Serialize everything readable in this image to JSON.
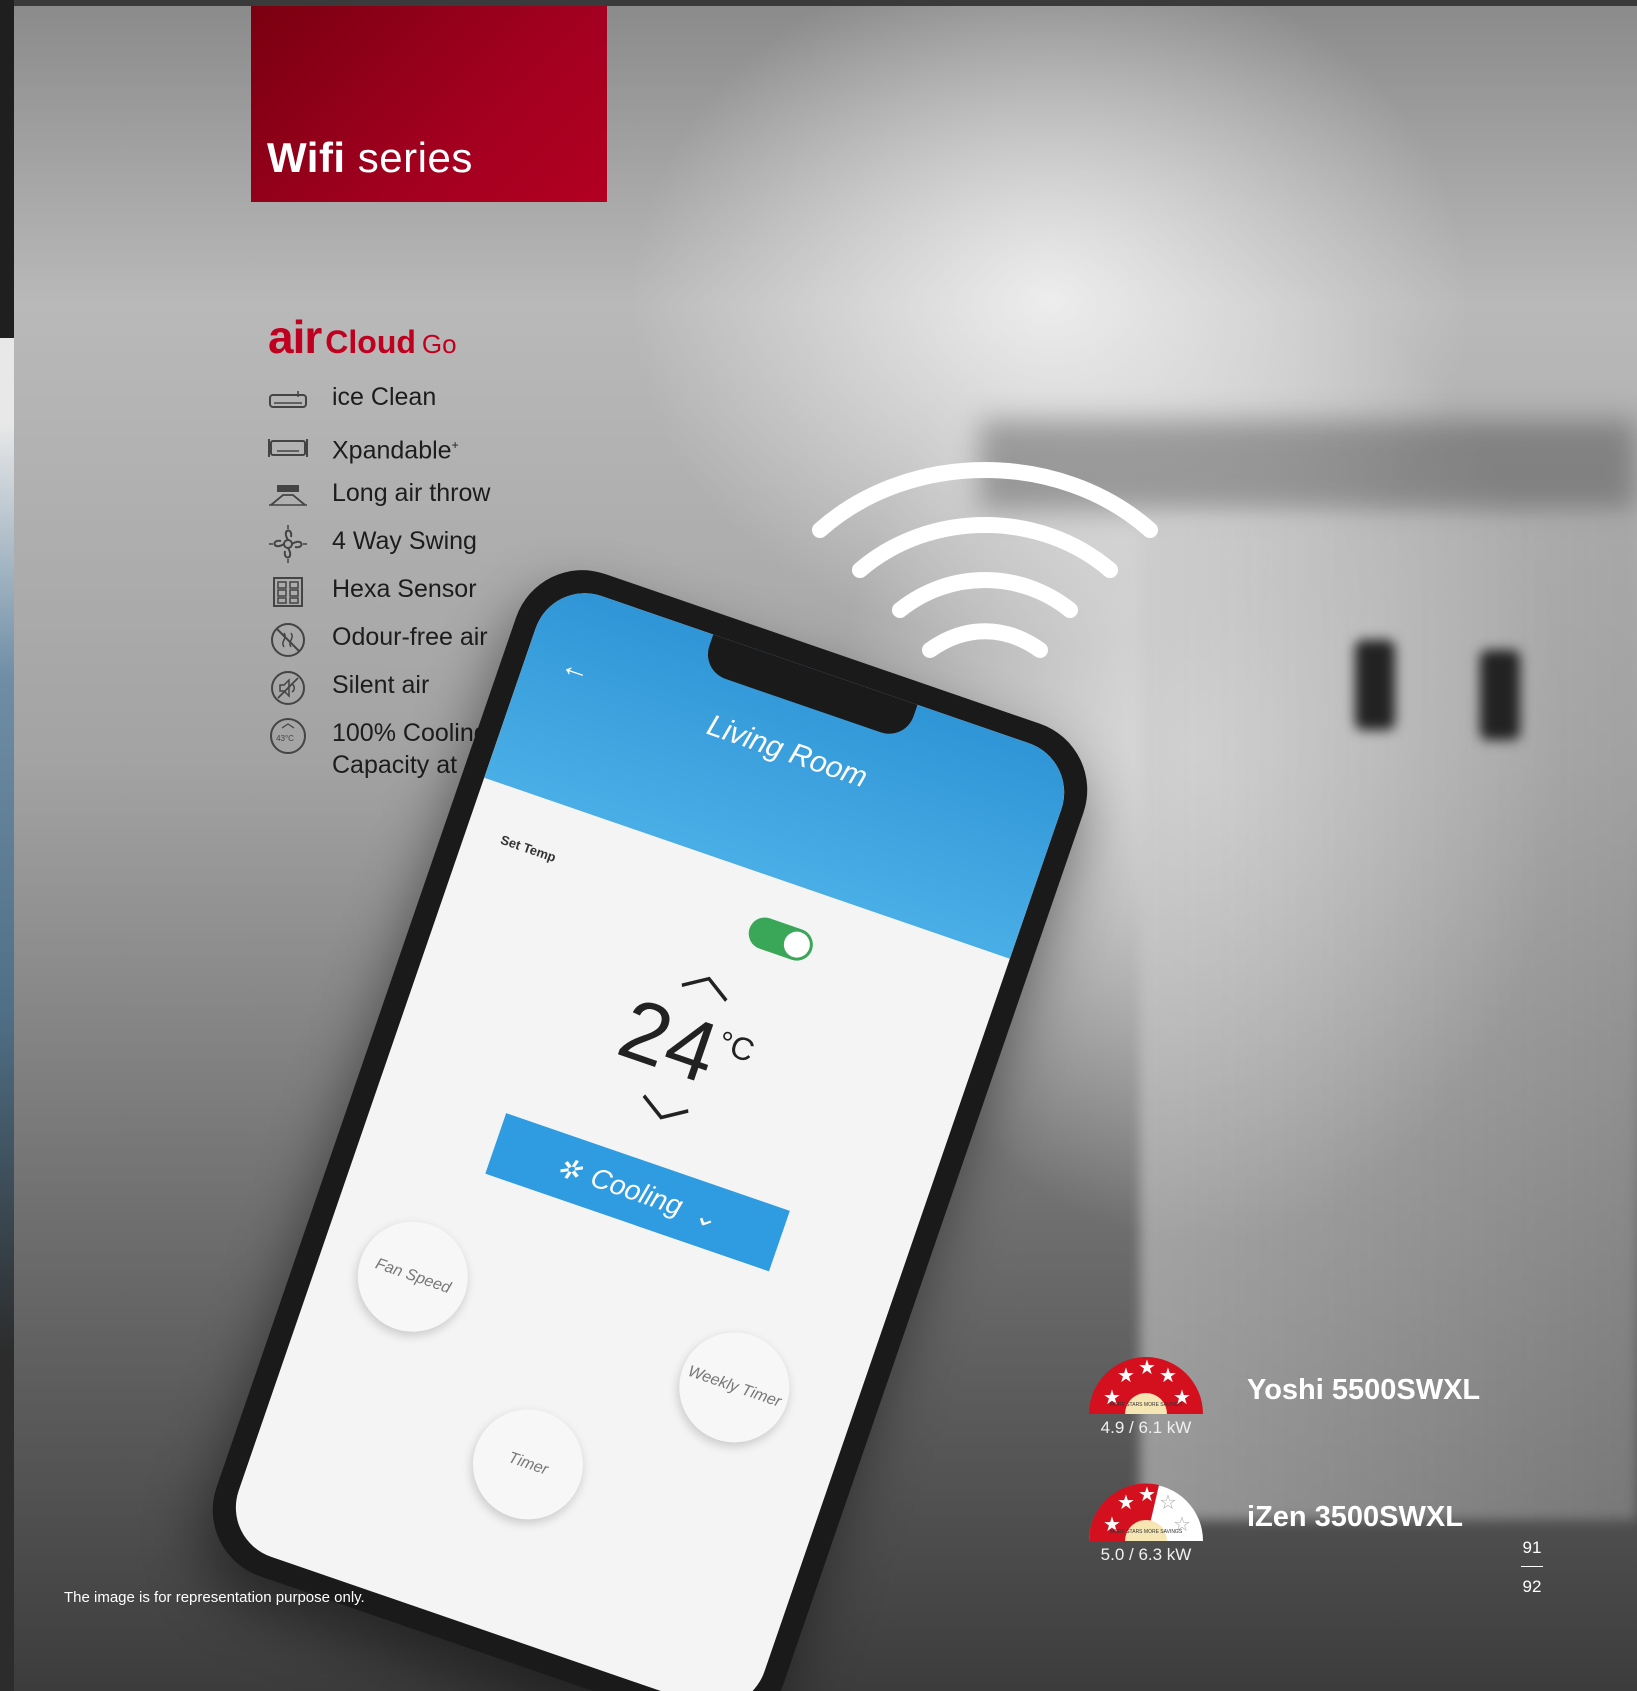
{
  "header": {
    "series_bold": "Wifi",
    "series_rest": "series"
  },
  "brand": {
    "air": "air",
    "cloud": "Cloud",
    "go": "Go"
  },
  "features": [
    {
      "icon": "ac-unit-icon",
      "label": "ice Clean"
    },
    {
      "icon": "expandable-unit-icon",
      "label": "Xpandable",
      "sup": "+"
    },
    {
      "icon": "air-throw-icon",
      "label": "Long air throw"
    },
    {
      "icon": "fan-swing-icon",
      "label": "4 Way Swing"
    },
    {
      "icon": "hexa-sensor-icon",
      "label": "Hexa Sensor"
    },
    {
      "icon": "odour-free-icon",
      "label": "Odour-free air"
    },
    {
      "icon": "silent-icon",
      "label": "Silent air"
    },
    {
      "icon": "cooling-capacity-icon",
      "label_line1": "100% Cooling",
      "label_line2": "Capacity at 43˚C",
      "icon_text": "43°C"
    }
  ],
  "phone": {
    "room": "Living Room",
    "set_temp": "Set Temp",
    "temperature": "24",
    "unit": "°C",
    "mode": "Cooling",
    "buttons": [
      "Fan Speed",
      "Weekly Timer",
      "Timer"
    ]
  },
  "products": [
    {
      "name": "Yoshi 5500SWXL",
      "rating": "4.9 / 6.1 kW",
      "stars": 5,
      "badge_text": "MORE STARS MORE SAVINGS"
    },
    {
      "name": "iZen 3500SWXL",
      "rating": "5.0 / 6.3 kW",
      "stars": 3,
      "badge_text": "MORE STARS MORE SAVINGS"
    }
  ],
  "page_numbers": {
    "top": "91",
    "bottom": "92"
  },
  "disclaimer": "The image is for representation purpose only.",
  "colors": {
    "brand_red": "#c0001f",
    "title_red": "#a2001f",
    "app_blue": "#2f9be0"
  }
}
